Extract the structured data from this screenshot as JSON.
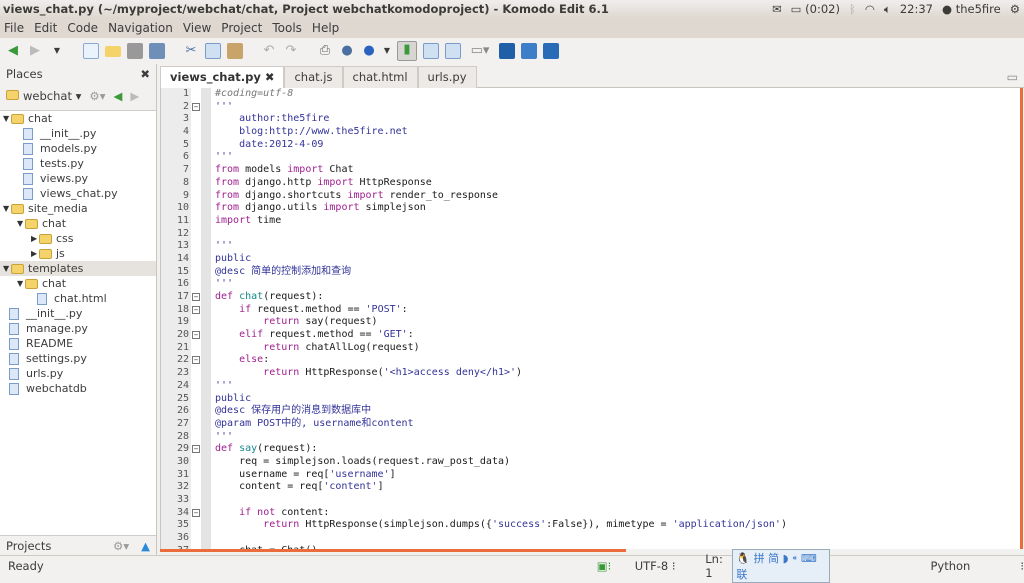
{
  "window": {
    "title": "views_chat.py (~/myproject/webchat/chat, Project webchatkomodoproject) - Komodo Edit 6.1"
  },
  "tray": {
    "battery": "(0:02)",
    "time": "22:37",
    "user": "the5fire"
  },
  "menu": [
    "File",
    "Edit",
    "Code",
    "Navigation",
    "View",
    "Project",
    "Tools",
    "Help"
  ],
  "toolbar_icons": [
    "back-icon",
    "forward-icon",
    "dropdown-icon",
    "new-file-icon",
    "open-folder-icon",
    "save-icon",
    "save-all-icon",
    "cut-icon",
    "copy-icon",
    "paste-icon",
    "undo-icon",
    "redo-icon",
    "print-icon",
    "help-icon",
    "browser-icon",
    "toggle-left-pane-icon",
    "toggle-bottom-pane-icon",
    "toggle-right-pane-icon",
    "keyboard-icon",
    "komodo-icon",
    "refresh-icon",
    "komodo-site-icon"
  ],
  "sidebar": {
    "title": "Places",
    "root": "webchat",
    "projects_label": "Projects",
    "tree": [
      {
        "label": "chat",
        "type": "folder",
        "depth": 0,
        "open": true
      },
      {
        "label": "__init__.py",
        "type": "file",
        "depth": 1
      },
      {
        "label": "models.py",
        "type": "file",
        "depth": 1
      },
      {
        "label": "tests.py",
        "type": "file",
        "depth": 1
      },
      {
        "label": "views.py",
        "type": "file",
        "depth": 1
      },
      {
        "label": "views_chat.py",
        "type": "file",
        "depth": 1
      },
      {
        "label": "site_media",
        "type": "folder",
        "depth": 0,
        "open": true
      },
      {
        "label": "chat",
        "type": "folder",
        "depth": 1,
        "open": true
      },
      {
        "label": "css",
        "type": "folder",
        "depth": 2,
        "open": false
      },
      {
        "label": "js",
        "type": "folder",
        "depth": 2,
        "open": false
      },
      {
        "label": "templates",
        "type": "folder",
        "depth": 0,
        "open": true,
        "selected": true
      },
      {
        "label": "chat",
        "type": "folder",
        "depth": 1,
        "open": true
      },
      {
        "label": "chat.html",
        "type": "file",
        "depth": 2
      },
      {
        "label": "__init__.py",
        "type": "file",
        "depth": 0
      },
      {
        "label": "manage.py",
        "type": "file",
        "depth": 0
      },
      {
        "label": "README",
        "type": "file",
        "depth": 0
      },
      {
        "label": "settings.py",
        "type": "file",
        "depth": 0
      },
      {
        "label": "urls.py",
        "type": "file",
        "depth": 0
      },
      {
        "label": "webchatdb",
        "type": "file",
        "depth": 0
      }
    ]
  },
  "tabs": [
    {
      "label": "views_chat.py",
      "active": true
    },
    {
      "label": "chat.js"
    },
    {
      "label": "chat.html"
    },
    {
      "label": "urls.py"
    }
  ],
  "editor": {
    "folds": {
      "2": "box",
      "17": "box",
      "18": "box",
      "20": "box",
      "22": "box",
      "29": "box",
      "34": "box"
    },
    "lines": [
      [
        [
          "#coding=utf-8",
          "cm"
        ]
      ],
      [
        [
          "'''",
          "ds"
        ]
      ],
      [
        [
          "    author:the5fire",
          "ds"
        ]
      ],
      [
        [
          "    blog:http://www.the5fire.net",
          "ds"
        ]
      ],
      [
        [
          "    date:2012-4-09",
          "ds"
        ]
      ],
      [
        [
          "'''",
          "ds"
        ]
      ],
      [
        [
          "from",
          "kw"
        ],
        [
          " models ",
          "pl"
        ],
        [
          "import",
          "kw"
        ],
        [
          " Chat",
          "pl"
        ]
      ],
      [
        [
          "from",
          "kw"
        ],
        [
          " django.http ",
          "pl"
        ],
        [
          "import",
          "kw"
        ],
        [
          " HttpResponse",
          "pl"
        ]
      ],
      [
        [
          "from",
          "kw"
        ],
        [
          " django.shortcuts ",
          "pl"
        ],
        [
          "import",
          "kw"
        ],
        [
          " render_to_response",
          "pl"
        ]
      ],
      [
        [
          "from",
          "kw"
        ],
        [
          " django.utils ",
          "pl"
        ],
        [
          "import",
          "kw"
        ],
        [
          " simplejson",
          "pl"
        ]
      ],
      [
        [
          "import",
          "kw"
        ],
        [
          " time",
          "pl"
        ]
      ],
      [],
      [
        [
          "'''",
          "ds"
        ]
      ],
      [
        [
          "public",
          "ds"
        ]
      ],
      [
        [
          "@desc 简单的控制添加和查询",
          "ds"
        ]
      ],
      [
        [
          "'''",
          "ds"
        ]
      ],
      [
        [
          "def",
          "kw"
        ],
        [
          " ",
          "pl"
        ],
        [
          "chat",
          "fn"
        ],
        [
          "(request):",
          "pl"
        ]
      ],
      [
        [
          "    ",
          "pl"
        ],
        [
          "if",
          "kw"
        ],
        [
          " request.method == ",
          "pl"
        ],
        [
          "'POST'",
          "st"
        ],
        [
          ":",
          "pl"
        ]
      ],
      [
        [
          "        ",
          "pl"
        ],
        [
          "return",
          "kw"
        ],
        [
          " say(request)",
          "pl"
        ]
      ],
      [
        [
          "    ",
          "pl"
        ],
        [
          "elif",
          "kw"
        ],
        [
          " request.method == ",
          "pl"
        ],
        [
          "'GET'",
          "st"
        ],
        [
          ":",
          "pl"
        ]
      ],
      [
        [
          "        ",
          "pl"
        ],
        [
          "return",
          "kw"
        ],
        [
          " chatAllLog(request)",
          "pl"
        ]
      ],
      [
        [
          "    ",
          "pl"
        ],
        [
          "else",
          "kw"
        ],
        [
          ":",
          "pl"
        ]
      ],
      [
        [
          "        ",
          "pl"
        ],
        [
          "return",
          "kw"
        ],
        [
          " HttpResponse(",
          "pl"
        ],
        [
          "'<h1>access deny</h1>'",
          "st"
        ],
        [
          ")",
          "pl"
        ]
      ],
      [
        [
          "'''",
          "ds"
        ]
      ],
      [
        [
          "public",
          "ds"
        ]
      ],
      [
        [
          "@desc 保存用户的消息到数据库中",
          "ds"
        ]
      ],
      [
        [
          "@param POST中的, username和content",
          "ds"
        ]
      ],
      [
        [
          "'''",
          "ds"
        ]
      ],
      [
        [
          "def",
          "kw"
        ],
        [
          " ",
          "pl"
        ],
        [
          "say",
          "fn"
        ],
        [
          "(request):",
          "pl"
        ]
      ],
      [
        [
          "    req = simplejson.loads(request.raw_post_data)",
          "pl"
        ]
      ],
      [
        [
          "    username = req[",
          "pl"
        ],
        [
          "'username'",
          "st"
        ],
        [
          "]",
          "pl"
        ]
      ],
      [
        [
          "    content = req[",
          "pl"
        ],
        [
          "'content'",
          "st"
        ],
        [
          "]",
          "pl"
        ]
      ],
      [],
      [
        [
          "    ",
          "pl"
        ],
        [
          "if",
          "kw"
        ],
        [
          " ",
          "pl"
        ],
        [
          "not",
          "kw"
        ],
        [
          " content:",
          "pl"
        ]
      ],
      [
        [
          "        ",
          "pl"
        ],
        [
          "return",
          "kw"
        ],
        [
          " HttpResponse(simplejson.dumps({",
          "pl"
        ],
        [
          "'success'",
          "st"
        ],
        [
          ":False}), mimetype = ",
          "pl"
        ],
        [
          "'application/json'",
          "st"
        ],
        [
          ")",
          "pl"
        ]
      ],
      [],
      [
        [
          "    chat = Chat()",
          "pl"
        ]
      ]
    ]
  },
  "status": {
    "ready": "Ready",
    "encoding": "UTF-8",
    "position": "Ln: 1",
    "ime": "拼 简",
    "ime_extra": "联",
    "language": "Python"
  }
}
